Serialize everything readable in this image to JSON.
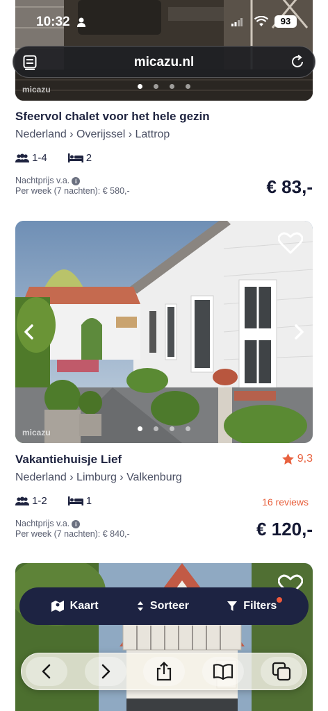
{
  "status_bar": {
    "time": "10:32",
    "battery": "93"
  },
  "browser": {
    "url": "micazu.nl"
  },
  "photo_watermark": "micazu",
  "listings": [
    {
      "title": "Sfeervol chalet voor het hele gezin",
      "location": "Nederland › Overijssel › Lattrop",
      "guests": "1-4",
      "bedrooms": "2",
      "price_label": "Nachtprijs v.a.",
      "week_price": "Per week (7 nachten): € 580,-",
      "price": "€ 83,-"
    },
    {
      "title": "Vakantiehuisje Lief",
      "location": "Nederland › Limburg › Valkenburg",
      "rating": "9,3",
      "reviews": "16 reviews",
      "guests": "1-2",
      "bedrooms": "1",
      "price_label": "Nachtprijs v.a.",
      "week_price": "Per week (7 nachten): € 840,-",
      "price": "€ 120,-"
    }
  ],
  "action_bar": {
    "map": "Kaart",
    "sort": "Sorteer",
    "filters": "Filters"
  },
  "colors": {
    "navy": "#1d2342",
    "accent": "#e8613e",
    "badge": "#f05a3c"
  }
}
